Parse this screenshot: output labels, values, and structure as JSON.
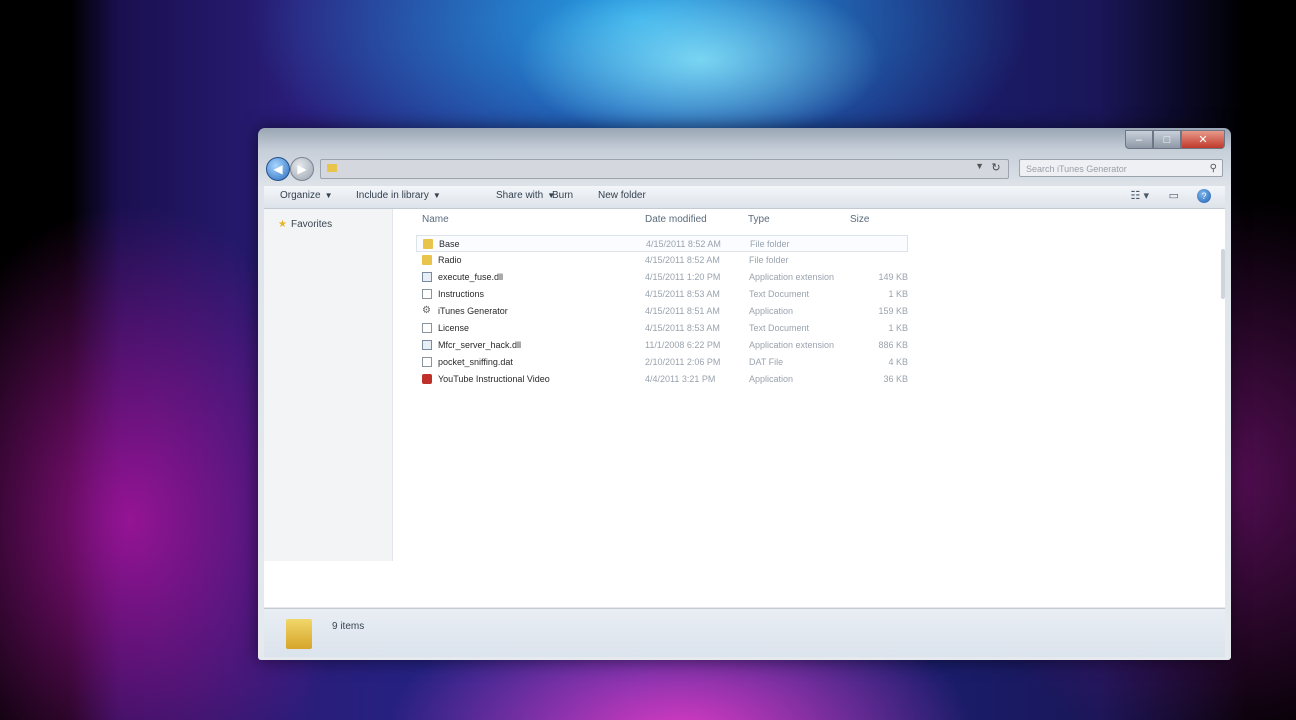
{
  "window": {
    "address_path": "",
    "search_placeholder": "Search iTunes Generator",
    "caption": {
      "minimize": "–",
      "maximize": "□",
      "close": "✕"
    }
  },
  "toolbar": {
    "organize": "Organize",
    "include_library": "Include in library",
    "share_with": "Share with",
    "burn": "Burn",
    "new_folder": "New folder"
  },
  "navpane": {
    "favorites": "Favorites"
  },
  "columns": {
    "name": "Name",
    "date": "Date modified",
    "type": "Type",
    "size": "Size"
  },
  "files": [
    {
      "name": "Base",
      "date": "4/15/2011 8:52 AM",
      "type": "File folder",
      "size": "",
      "icon": "folder-icon"
    },
    {
      "name": "Radio",
      "date": "4/15/2011 8:52 AM",
      "type": "File folder",
      "size": "",
      "icon": "folder-icon"
    },
    {
      "name": "execute_fuse.dll",
      "date": "4/15/2011 1:20 PM",
      "type": "Application extension",
      "size": "149 KB",
      "icon": "dll-icon"
    },
    {
      "name": "Instructions",
      "date": "4/15/2011 8:53 AM",
      "type": "Text Document",
      "size": "1 KB",
      "icon": "text-file-icon"
    },
    {
      "name": "iTunes Generator",
      "date": "4/15/2011 8:51 AM",
      "type": "Application",
      "size": "159 KB",
      "icon": "gear-icon"
    },
    {
      "name": "License",
      "date": "4/15/2011 8:53 AM",
      "type": "Text Document",
      "size": "1 KB",
      "icon": "text-file-icon"
    },
    {
      "name": "Mfcr_server_hack.dll",
      "date": "11/1/2008 6:22 PM",
      "type": "Application extension",
      "size": "886 KB",
      "icon": "dll-icon"
    },
    {
      "name": "pocket_sniffing.dat",
      "date": "2/10/2011 2:06 PM",
      "type": "DAT File",
      "size": "4 KB",
      "icon": "dat-file-icon"
    },
    {
      "name": "YouTube Instructional Video",
      "date": "4/4/2011 3:21 PM",
      "type": "Application",
      "size": "36 KB",
      "icon": "video-app-icon"
    }
  ],
  "details": {
    "item_count": "9 items"
  },
  "colors": {
    "accent": "#2a6fc0",
    "folder": "#e8c44a",
    "close": "#c0392b"
  }
}
